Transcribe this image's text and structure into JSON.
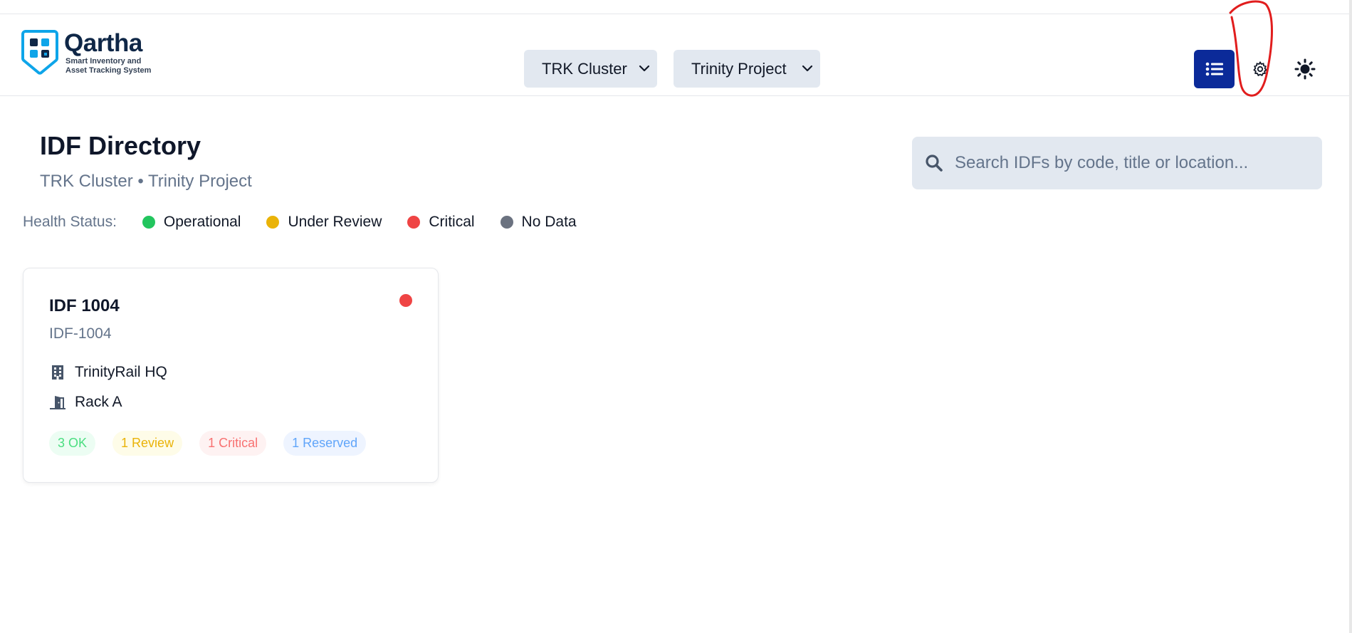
{
  "brand": {
    "name": "Qartha",
    "tagline_line1": "Smart Inventory and",
    "tagline_line2": "Asset Tracking System"
  },
  "header": {
    "cluster_select": {
      "value": "TRK Cluster"
    },
    "project_select": {
      "value": "Trinity Project"
    },
    "icons": [
      "list-icon",
      "gear-icon",
      "sun-icon"
    ]
  },
  "page": {
    "title": "IDF Directory",
    "subtitle": "TRK Cluster • Trinity Project"
  },
  "search": {
    "placeholder": "Search IDFs by code, title or location..."
  },
  "health": {
    "label": "Health Status:",
    "items": [
      {
        "label": "Operational",
        "color": "#22c55e"
      },
      {
        "label": "Under Review",
        "color": "#eab308"
      },
      {
        "label": "Critical",
        "color": "#ef4444"
      },
      {
        "label": "No Data",
        "color": "#6b7280"
      }
    ]
  },
  "cards": [
    {
      "title": "IDF 1004",
      "code": "IDF-1004",
      "status_color": "#ef4444",
      "building": "TrinityRail HQ",
      "room": "Rack A",
      "badges": [
        {
          "text": "3 OK",
          "fg": "#4ade80",
          "bg": "#ecfdf3"
        },
        {
          "text": "1 Review",
          "fg": "#eab308",
          "bg": "#fefce8"
        },
        {
          "text": "1 Critical",
          "fg": "#f87171",
          "bg": "#fef2f2"
        },
        {
          "text": "1 Reserved",
          "fg": "#60a5fa",
          "bg": "#eef4ff"
        }
      ]
    }
  ],
  "colors": {
    "accent": "#0b2a99",
    "annotation": "#e11d1d"
  }
}
